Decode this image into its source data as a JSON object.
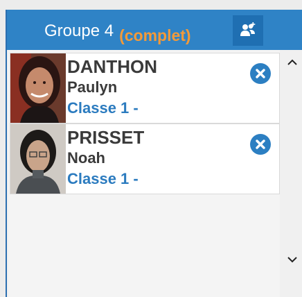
{
  "header": {
    "title": "Groupe 4",
    "status": "(complet)",
    "icon": "group-add-icon"
  },
  "members": [
    {
      "lastname": "DANTHON",
      "firstname": "Paulyn",
      "classe": "Classe 1 -",
      "remove_icon": "remove-circle-icon"
    },
    {
      "lastname": "PRISSET",
      "firstname": "Noah",
      "classe": "Classe 1 -",
      "remove_icon": "remove-circle-icon"
    }
  ],
  "scrollbar": {
    "up_icon": "chevron-up-icon",
    "down_icon": "chevron-down-icon"
  },
  "colors": {
    "header": "#2f83c6",
    "status": "#f39a39",
    "classe": "#2b7bbf",
    "remove": "#2c7fc2"
  }
}
